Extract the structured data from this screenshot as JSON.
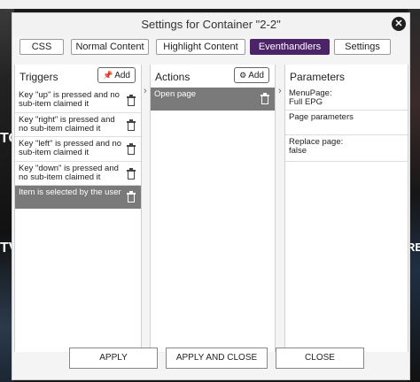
{
  "background": {
    "tile_text_left_1": "TO",
    "tile_text_left_2": "TV",
    "tile_text_right_1": "RE"
  },
  "dialog": {
    "title": "Settings for Container \"2-2\"",
    "close_glyph": "✕"
  },
  "tabs": [
    {
      "label": "CSS",
      "active": false
    },
    {
      "label": "Normal Content",
      "active": false
    },
    {
      "label": "Highlight Content",
      "active": false
    },
    {
      "label": "Eventhandlers",
      "active": true
    },
    {
      "label": "Settings",
      "active": false
    }
  ],
  "triggers": {
    "title": "Triggers",
    "add_label": "Add",
    "items": [
      {
        "text": "Key \"up\" is pressed and no sub-item claimed it",
        "selected": false
      },
      {
        "text": "Key \"right\" is pressed and no sub-item claimed it",
        "selected": false
      },
      {
        "text": "Key \"left\" is pressed and no sub-item claimed it",
        "selected": false
      },
      {
        "text": "Key \"down\" is pressed and no sub-item claimed it",
        "selected": false
      },
      {
        "text": "Item is selected by the user",
        "selected": true
      }
    ]
  },
  "actions": {
    "title": "Actions",
    "add_label": "Add",
    "items": [
      {
        "text": "Open page",
        "selected": true
      }
    ]
  },
  "parameters": {
    "title": "Parameters",
    "rows": [
      {
        "label": "MenuPage:",
        "value": "Full EPG"
      },
      {
        "label": "Page parameters",
        "value": ""
      },
      {
        "label": "Replace page:",
        "value": "false"
      }
    ]
  },
  "footer": {
    "apply": "APPLY",
    "apply_close": "APPLY AND CLOSE",
    "close": "CLOSE"
  },
  "icons": {
    "chevron": "›",
    "pin": "📌"
  },
  "colors": {
    "active_tab": "#4b2367",
    "selected_row": "#7a7a7a"
  }
}
